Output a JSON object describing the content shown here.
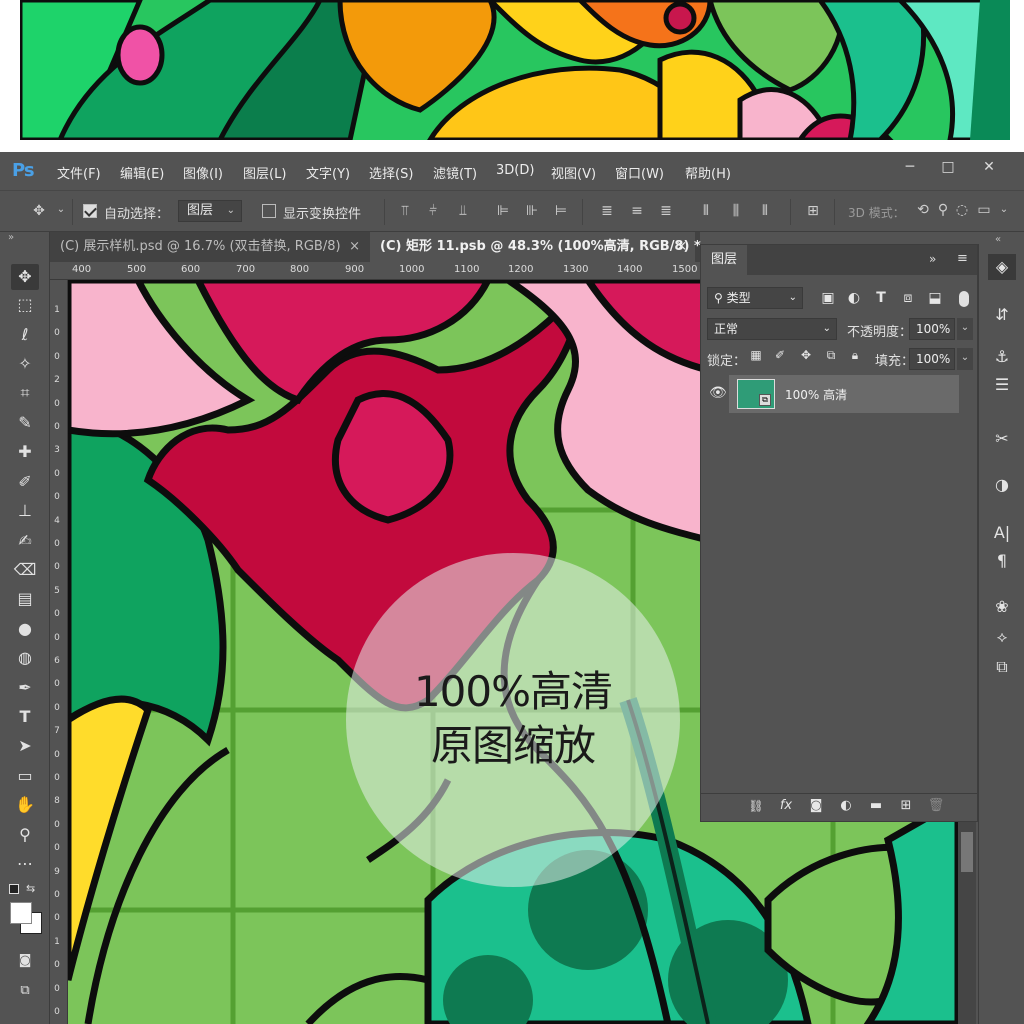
{
  "app": {
    "logo": "Ps"
  },
  "menu": [
    "文件(F)",
    "编辑(E)",
    "图像(I)",
    "图层(L)",
    "文字(Y)",
    "选择(S)",
    "滤镜(T)",
    "3D(D)",
    "视图(V)",
    "窗口(W)",
    "帮助(H)"
  ],
  "window_controls": [
    "─",
    "□",
    "✕"
  ],
  "options": {
    "auto_select_label": "自动选择：",
    "auto_select_value": "图层",
    "show_transform_label": "显示变换控件",
    "mode3d_label": "3D 模式："
  },
  "tabs": [
    {
      "label": "(C) 展示样机.psd @ 16.7% (双击替换, RGB/8)",
      "close": "×"
    },
    {
      "label": "(C) 矩形 11.psb @ 48.3% (100%高清, RGB/8) *",
      "close": "×"
    }
  ],
  "ruler_top": [
    "400",
    "500",
    "600",
    "700",
    "800",
    "900",
    "1000",
    "1100",
    "1200",
    "1300",
    "1400",
    "1500"
  ],
  "ruler_left": [
    "1",
    "0",
    "0",
    "2",
    "0",
    "0",
    "3",
    "0",
    "0",
    "4",
    "0",
    "0",
    "5",
    "0",
    "0",
    "6",
    "0",
    "0",
    "7",
    "0",
    "0",
    "8",
    "0",
    "0",
    "9",
    "0",
    "0",
    "1",
    "0",
    "0",
    "0"
  ],
  "layers_panel": {
    "title": "图层",
    "filter_value": "类型",
    "blend_mode": "正常",
    "opacity_label": "不透明度：",
    "opacity_value": "100%",
    "lock_label": "锁定：",
    "fill_label": "填充：",
    "fill_value": "100%",
    "layer_name": "100% 高清",
    "footer_fx": "fx"
  },
  "overlay": {
    "line1": "100%高清",
    "line2": "原图缩放"
  },
  "colors": {
    "ps_bg": "#535353",
    "layer_thumb": "#2f9c77",
    "flower_red": "#d6195a",
    "flower_pink": "#f8b4cc",
    "leaf_green": "#0fa35f",
    "bg_green": "#7cc55a",
    "teal": "#1bc08d"
  },
  "icons": {
    "tools": [
      "move-icon",
      "marquee-icon",
      "lasso-icon",
      "magic-wand-icon",
      "crop-icon",
      "eyedropper-icon",
      "healing-icon",
      "brush-icon",
      "stamp-icon",
      "history-brush-icon",
      "eraser-icon",
      "gradient-icon",
      "blur-icon",
      "dodge-icon",
      "pen-icon",
      "type-icon",
      "path-select-icon",
      "rectangle-icon",
      "hand-icon",
      "zoom-icon",
      "more-icon"
    ]
  }
}
